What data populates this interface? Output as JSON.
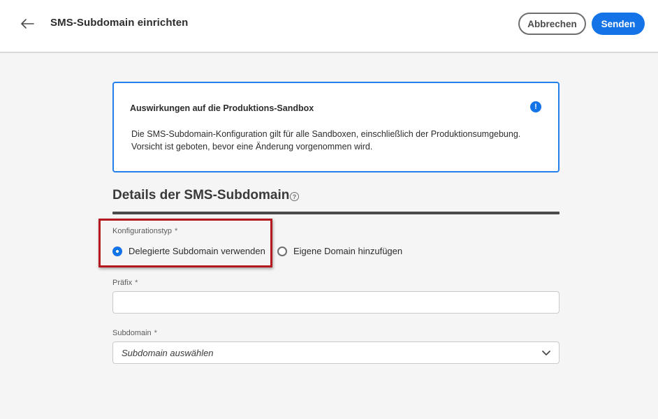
{
  "header": {
    "back_icon": "arrow-left-icon",
    "title": "SMS-Subdomain einrichten",
    "cancel_label": "Abbrechen",
    "send_label": "Senden"
  },
  "alert": {
    "title": "Auswirkungen auf die Produktions-Sandbox",
    "icon": "info-icon",
    "icon_glyph": "!",
    "line1": "Die SMS-Subdomain-Konfiguration gilt für alle Sandboxen, einschließlich der Produktionsumgebung.",
    "line2": "Vorsicht ist geboten, bevor eine Änderung vorgenommen wird."
  },
  "section": {
    "title": "Details der SMS-Subdomain",
    "help_glyph": "?"
  },
  "config_type": {
    "label": "Konfigurationstyp",
    "required_mark": "*",
    "options": [
      {
        "label": "Delegierte Subdomain verwenden",
        "selected": true
      },
      {
        "label": "Eigene Domain hinzufügen",
        "selected": false
      }
    ]
  },
  "prefix": {
    "label": "Präfix",
    "required_mark": "*",
    "value": ""
  },
  "subdomain": {
    "label": "Subdomain",
    "required_mark": "*",
    "placeholder": "Subdomain auswählen",
    "chevron_icon": "chevron-down-icon"
  },
  "colors": {
    "accent": "#1473e6",
    "alert_border": "#2680eb",
    "highlight": "#b3191e"
  }
}
